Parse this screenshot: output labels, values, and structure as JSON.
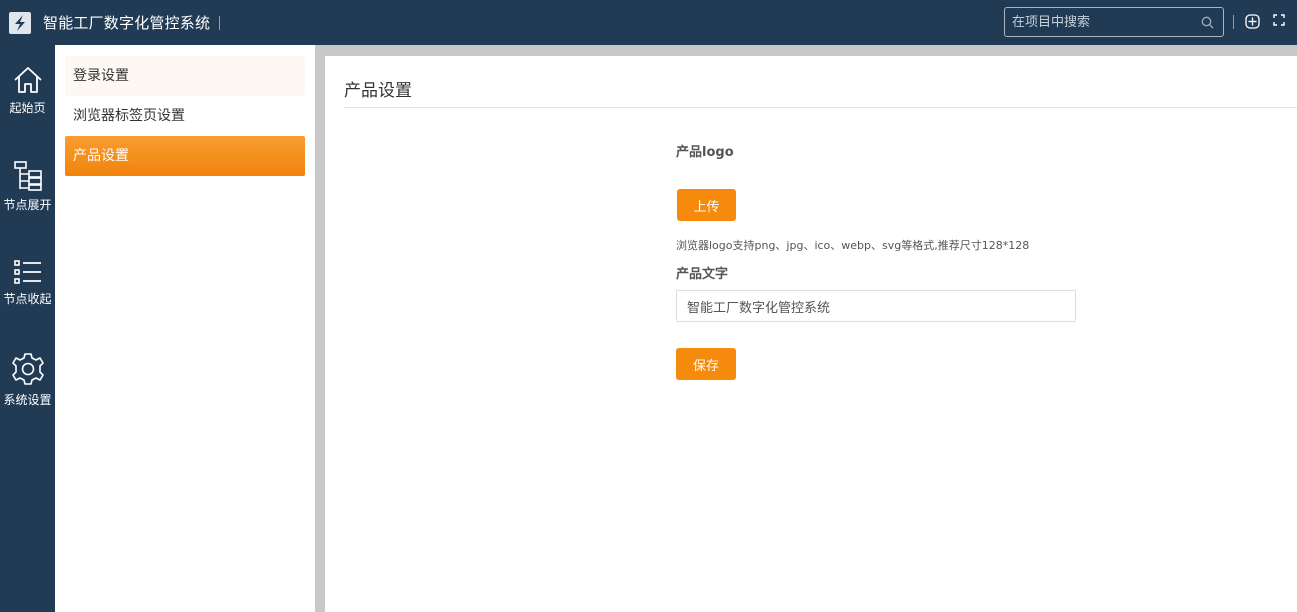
{
  "header": {
    "app_title": "智能工厂数字化管控系统",
    "search_placeholder": "在项目中搜索",
    "colors": {
      "background": "#213b55",
      "accent": "#f58a0d"
    }
  },
  "rail": {
    "items": [
      {
        "label": "起始页",
        "icon": "home-icon"
      },
      {
        "label": "节点展开",
        "icon": "tree-expand-icon"
      },
      {
        "label": "节点收起",
        "icon": "list-collapse-icon"
      },
      {
        "label": "系统设置",
        "icon": "gear-icon"
      }
    ]
  },
  "submenu": {
    "items": [
      {
        "label": "登录设置",
        "state": "hover"
      },
      {
        "label": "浏览器标签页设置",
        "state": "normal"
      },
      {
        "label": "产品设置",
        "state": "active"
      }
    ]
  },
  "main": {
    "title": "产品设置",
    "logo_label": "产品logo",
    "upload_label": "上传",
    "hint": "浏览器logo支持png、jpg、ico、webp、svg等格式,推荐尺寸128*128",
    "text_label": "产品文字",
    "text_value": "智能工厂数字化管控系统",
    "save_label": "保存"
  }
}
